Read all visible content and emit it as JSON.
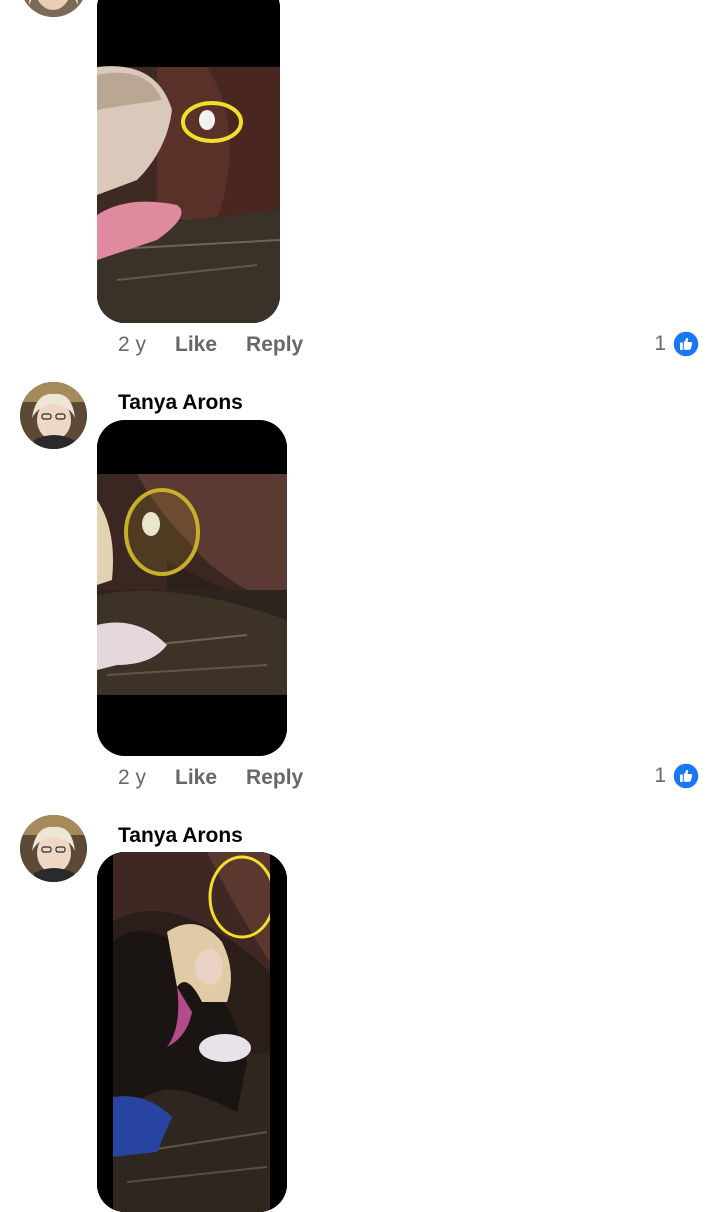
{
  "comments": [
    {
      "author": "",
      "age": "2 y",
      "like_label": "Like",
      "reply_label": "Reply",
      "reaction_count": "1"
    },
    {
      "author": "Tanya Arons",
      "age": "2 y",
      "like_label": "Like",
      "reply_label": "Reply",
      "reaction_count": "1"
    },
    {
      "author": "Tanya Arons",
      "age": "",
      "like_label": "",
      "reply_label": "",
      "reaction_count": ""
    }
  ],
  "colors": {
    "like_blue": "#1877f2",
    "annotation_circle": "#f2df2a",
    "meta_text": "#65676b"
  },
  "icons": {
    "reaction": "thumbs-up-icon"
  }
}
